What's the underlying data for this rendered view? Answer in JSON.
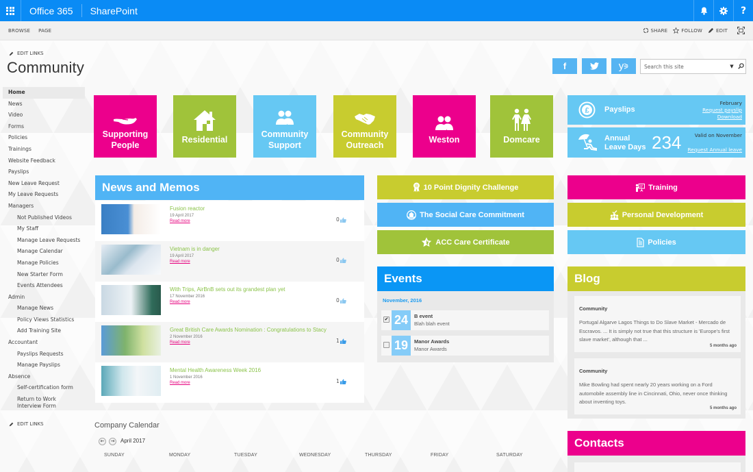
{
  "suitebar": {
    "brand": "Office 365",
    "app": "SharePoint",
    "icons": [
      "waffle-icon",
      "bell-icon",
      "gear-icon",
      "help-icon"
    ],
    "help_glyph": "?"
  },
  "ribbon": {
    "tabs": [
      "BROWSE",
      "PAGE"
    ],
    "actions": {
      "share": "SHARE",
      "follow": "FOLLOW",
      "edit": "EDIT"
    }
  },
  "site": {
    "edit_links_top": "EDIT LINKS",
    "title": "Community",
    "edit_links_bottom": "EDIT LINKS"
  },
  "leftnav": {
    "items": [
      {
        "label": "Home",
        "level": 0,
        "active": true
      },
      {
        "label": "News",
        "level": 0
      },
      {
        "label": "Video",
        "level": 0
      },
      {
        "label": "Forms",
        "level": 0
      },
      {
        "label": "Policies",
        "level": 0
      },
      {
        "label": "Trainings",
        "level": 0
      },
      {
        "label": "Website Feedback",
        "level": 0
      },
      {
        "label": "Payslips",
        "level": 0
      },
      {
        "label": "New Leave Request",
        "level": 0
      },
      {
        "label": "My Leave Requests",
        "level": 0
      },
      {
        "label": "Managers",
        "level": 0
      },
      {
        "label": "Not Published Videos",
        "level": 1
      },
      {
        "label": "My Staff",
        "level": 1
      },
      {
        "label": "Manage Leave Requests",
        "level": 1
      },
      {
        "label": "Manage Calendar",
        "level": 1
      },
      {
        "label": "Manage Policies",
        "level": 1
      },
      {
        "label": "New Starter Form",
        "level": 1
      },
      {
        "label": "Events Attendees",
        "level": 1
      },
      {
        "label": "Admin",
        "level": 0
      },
      {
        "label": "Manage News",
        "level": 1
      },
      {
        "label": "Policy Views Statistics",
        "level": 1
      },
      {
        "label": "Add Training Site",
        "level": 1
      },
      {
        "label": "Accountant",
        "level": 0
      },
      {
        "label": "Payslips Requests",
        "level": 1
      },
      {
        "label": "Manage Payslips",
        "level": 1
      },
      {
        "label": "Absence",
        "level": 0
      },
      {
        "label": "Self-certification form",
        "level": 1
      },
      {
        "label": "Return to Work Interview Form",
        "level": 1
      }
    ]
  },
  "social": {
    "facebook": "f",
    "yammer": "y"
  },
  "search": {
    "placeholder": "Search this site",
    "value": ""
  },
  "tiles": [
    {
      "label": "Supporting People",
      "icon": "helping-hand-icon",
      "color": "#ec008c"
    },
    {
      "label": "Residential",
      "icon": "house-icon",
      "color": "#a0c33a"
    },
    {
      "label": "Community Support",
      "icon": "people-group-icon",
      "color": "#66c8f3"
    },
    {
      "label": "Community Outreach",
      "icon": "handshake-icon",
      "color": "#c8cc2f"
    },
    {
      "label": "Weston",
      "icon": "people-group-icon",
      "color": "#ec008c"
    },
    {
      "label": "Domcare",
      "icon": "couple-icon",
      "color": "#a0c33a"
    }
  ],
  "payslips": {
    "title": "Payslips",
    "month": "February",
    "request_link": "Request payslip",
    "download_link": "Download"
  },
  "leave": {
    "title_line1": "Annual",
    "title_line2": "Leave Days",
    "days": "234",
    "valid": "Valid on November",
    "request_link": "Request Annual leave"
  },
  "news": {
    "header": "News and Memos",
    "read_more": "Read more",
    "items": [
      {
        "title": "Fusion reactor",
        "date": "19 April 2017",
        "likes": "0"
      },
      {
        "title": "Vietnam is in danger",
        "date": "19 April 2017",
        "likes": "0"
      },
      {
        "title": "With Trips, AirBnB sets out its grandest plan yet",
        "date": "17 November 2016",
        "likes": "0"
      },
      {
        "title": "Great British Care Awards Nomination : Congratulations to Stacy",
        "date": "2 November 2016",
        "likes": "1"
      },
      {
        "title": "Mental Health Awareness Week 2016",
        "date": "1 November 2016",
        "likes": "1"
      }
    ]
  },
  "middle_buttons": [
    {
      "label": "10 Point Dignity Challenge",
      "icon": "award-ribbon-icon",
      "color": "#c8cc2f"
    },
    {
      "label": "The Social Care Commitment",
      "icon": "care-home-icon",
      "color": "#50b4f5"
    },
    {
      "label": "ACC Care Certificate",
      "icon": "star-icon",
      "color": "#a0c33a"
    }
  ],
  "events": {
    "header": "Events",
    "month": "November, 2016",
    "items": [
      {
        "day": "24",
        "title": "B  event",
        "desc": "Blah blah event",
        "checked": true
      },
      {
        "day": "19",
        "title": "Manor Awards",
        "desc": "Manor Awards",
        "checked": false
      }
    ]
  },
  "right_buttons": [
    {
      "label": "Training",
      "icon": "presentation-icon",
      "color": "#ec008c"
    },
    {
      "label": "Personal Development",
      "icon": "team-check-icon",
      "color": "#c8cc2f"
    },
    {
      "label": "Policies",
      "icon": "document-icon",
      "color": "#66c8f3"
    }
  ],
  "blog": {
    "header": "Blog",
    "posts": [
      {
        "category": "Community",
        "text": "Portugal Algarve Lagos Things to Do Slave Market - Mercado de Escravos. ... It is simply not true that this structure is 'Europe's first slave market', although that ...",
        "time": "5 months ago"
      },
      {
        "category": "Community",
        "text": "Mike Bowling had spent nearly 20 years working on a Ford automobile assembly line in Cincinnati, Ohio, never once thinking about inventing toys.",
        "time": "5 months ago"
      }
    ]
  },
  "contacts": {
    "header": "Contacts"
  },
  "calendar": {
    "title": "Company Calendar",
    "month": "April 2017",
    "prev": "←",
    "next": "→",
    "days": [
      "SUNDAY",
      "MONDAY",
      "TUESDAY",
      "WEDNESDAY",
      "THURSDAY",
      "FRIDAY",
      "SATURDAY"
    ]
  },
  "colors": {
    "suitebar": "#0a8bf5",
    "news_header": "#50b4f5",
    "events_header": "#0a96f5",
    "blog_header": "#c8cc2f",
    "contacts_header": "#ec008c",
    "news_title": "#8bc34a",
    "read_more": "#e6007e"
  }
}
